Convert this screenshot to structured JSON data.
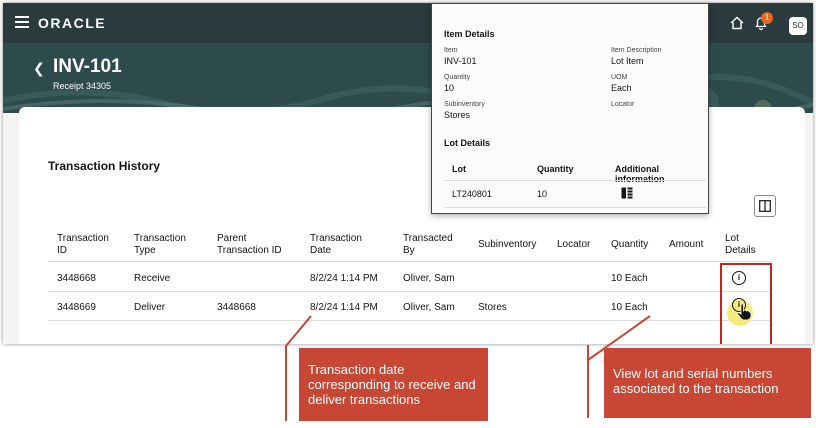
{
  "header": {
    "logo": "ORACLE",
    "notification_count": "1",
    "user_initials": "SO"
  },
  "page": {
    "title": "INV-101",
    "subtitle": "Receipt 34305"
  },
  "section": {
    "title": "Transaction History"
  },
  "table": {
    "columns": [
      {
        "line1": "Transaction",
        "line2": "ID"
      },
      {
        "line1": "Transaction",
        "line2": "Type"
      },
      {
        "line1": "Parent",
        "line2": "Transaction ID"
      },
      {
        "line1": "Transaction",
        "line2": "Date"
      },
      {
        "line1": "Transacted",
        "line2": "By"
      },
      {
        "line1": "Subinventory",
        "line2": ""
      },
      {
        "line1": "Locator",
        "line2": ""
      },
      {
        "line1": "Quantity",
        "line2": ""
      },
      {
        "line1": "Amount",
        "line2": ""
      },
      {
        "line1": "Lot",
        "line2": "Details"
      }
    ],
    "rows": [
      {
        "id": "3448668",
        "type": "Receive",
        "parent": "",
        "date": "8/2/24 1:14 PM",
        "by": "Oliver, Sam",
        "subinventory": "",
        "locator": "",
        "quantity": "10 Each",
        "amount": ""
      },
      {
        "id": "3448669",
        "type": "Deliver",
        "parent": "3448668",
        "date": "8/2/24 1:14 PM",
        "by": "Oliver, Sam",
        "subinventory": "Stores",
        "locator": "",
        "quantity": "10 Each",
        "amount": ""
      }
    ]
  },
  "popup": {
    "item_details_title": "Item Details",
    "item_label": "Item",
    "item_value": "INV-101",
    "item_desc_label": "Item Description",
    "item_desc_value": "Lot Item",
    "quantity_label": "Quantity",
    "quantity_value": "10",
    "uom_label": "UOM",
    "uom_value": "Each",
    "subinventory_label": "Subinventory",
    "subinventory_value": "Stores",
    "locator_label": "Locator",
    "lot_details_title": "Lot Details",
    "lot_col": "Lot",
    "lot_qty_col": "Quantity",
    "lot_info_col": "Additional information",
    "lot_number": "LT240801",
    "lot_quantity": "10"
  },
  "callouts": {
    "date": "Transaction date corresponding to receive and deliver transactions",
    "lot": "View lot and serial numbers associated to the transaction"
  },
  "colors": {
    "header": "#2a3a3d",
    "banner": "#2d4b4d",
    "callout": "#c74634",
    "highlight": "#c0271b"
  }
}
